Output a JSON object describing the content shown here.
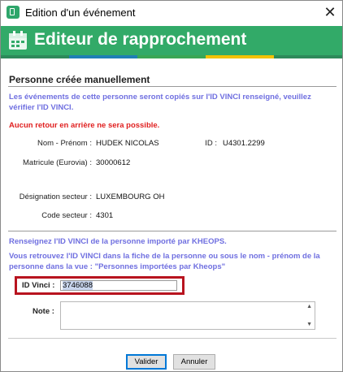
{
  "window": {
    "title": "Edition d'un événement",
    "close_glyph": "✕"
  },
  "banner": {
    "title": "Editeur de rapprochement",
    "icon": "calendar-icon"
  },
  "stripe_colors": [
    "#2d8a5a",
    "#1f7fb5",
    "#3aa655",
    "#f2c200",
    "#2d8a5a"
  ],
  "section": {
    "title": "Personne créée manuellement",
    "info": "Les événements de cette personne seront copiés sur l'ID VINCI renseigné, veuillez vérifier l'ID VINCI.",
    "warning": "Aucun retour en arrière ne sera possible."
  },
  "person": {
    "name_label": "Nom - Prénom :",
    "name_value": "HUDEK NICOLAS",
    "id_label": "ID :",
    "id_value": "U4301.2299",
    "matricule_label": "Matricule (Eurovia) :",
    "matricule_value": "30000612",
    "sector_label": "Désignation secteur :",
    "sector_value": "LUXEMBOURG OH",
    "sector_code_label": "Code secteur :",
    "sector_code_value": "4301"
  },
  "instructions": {
    "line1": "Renseignez l'ID VINCI de la personne importé par KHEOPS.",
    "line2": "Vous retrouvez l'ID VINCI dans la fiche de la personne ou sous le nom - prénom de la personne dans la vue : \"Personnes importées par Kheops\""
  },
  "form": {
    "vinci_label": "ID Vinci :",
    "vinci_value": "3746088",
    "note_label": "Note :",
    "note_value": ""
  },
  "buttons": {
    "validate": "Valider",
    "cancel": "Annuler"
  },
  "colors": {
    "banner": "#32aa68",
    "info_text": "#6f6fe0",
    "warning_text": "#e02020",
    "highlight_border": "#b8141f"
  }
}
